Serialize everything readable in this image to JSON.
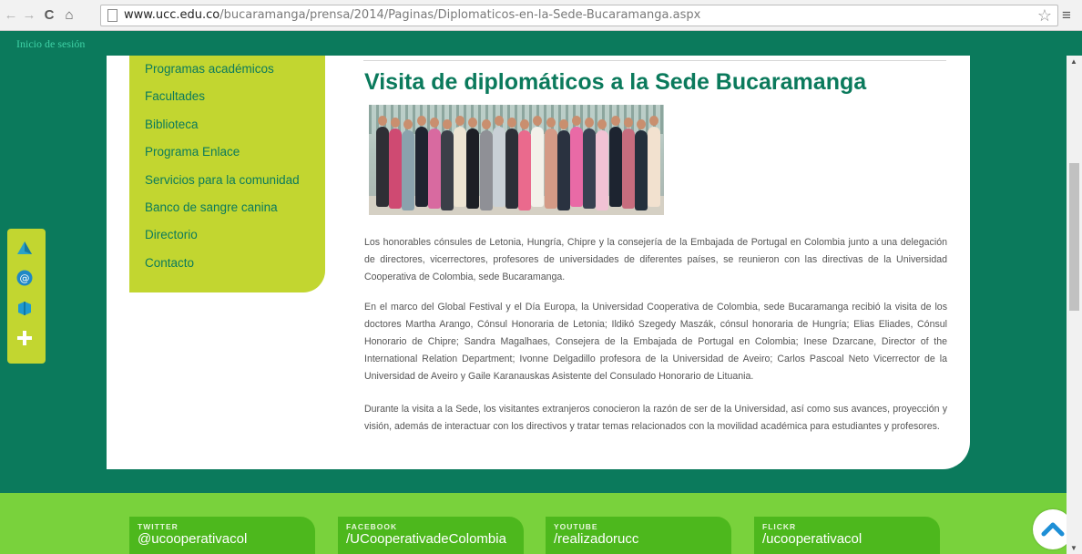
{
  "browser": {
    "url_domain": "www.ucc.edu.co",
    "url_path": "/bucaramanga/prensa/2014/Paginas/Diplomaticos-en-la-Sede-Bucaramanga.aspx",
    "back_icon": "←",
    "forward_icon": "→",
    "reload_icon": "C",
    "home_icon": "⌂",
    "star_icon": "☆",
    "menu_icon": "≡"
  },
  "header": {
    "login": "Inicio de sesión"
  },
  "left_menu": {
    "items": [
      "Programas académicos",
      "Facultades",
      "Biblioteca",
      "Programa Enlace",
      "Servicios para la comunidad",
      "Banco de sangre canina",
      "Directorio",
      "Contacto"
    ]
  },
  "article": {
    "title": "Visita de diplomáticos a la Sede Bucaramanga",
    "paragraphs": [
      "Los honorables cónsules de Letonia, Hungría, Chipre y la consejería de la Embajada de Portugal en Colombia junto a una delegación de directores, vicerrectores, profesores de universidades de diferentes países, se reunieron con las directivas de la Universidad Cooperativa de Colombia, sede Bucaramanga.",
      "En el marco del Global Festival y el Día Europa, la Universidad Cooperativa de Colombia, sede Bucaramanga recibió la visita de los doctores Martha Arango, Cónsul Honoraria de Letonia; Ildikó Szegedy Maszák, cónsul honoraria de Hungría; Elias Eliades, Cónsul Honorario de Chipre; Sandra Magalhaes, Consejera de la Embajada de Portugal en Colombia; Inese Dzarcane, Director of the International Relation Department; Ivonne Delgadillo profesora de la Universidad de Aveiro; Carlos Pascoal Neto Vicerrector de la Universidad de Aveiro y Gaile Karanauskas Asistente del Consulado Honorario de Lituania.",
      "Durante la visita a la Sede, los visitantes extranjeros conocieron la razón de ser de la Universidad, así como sus avances, proyección y visión, además de interactuar con los directivos y tratar temas relacionados con la movilidad académica para estudiantes y profesores."
    ]
  },
  "social": [
    {
      "kicker": "TWITTER",
      "handle": "@ucooperativacol"
    },
    {
      "kicker": "FACEBOOK",
      "handle": "/UCooperativadeColombia"
    },
    {
      "kicker": "YOUTUBE",
      "handle": "/realizadorucc"
    },
    {
      "kicker": "FLICKR",
      "handle": "/ucooperativacol"
    }
  ],
  "colors": {
    "page_bg": "#0b7a5c",
    "menu_bg": "#c2d630",
    "footer_bg": "#79d23c",
    "social_tile": "#4db81d"
  },
  "photo": {
    "person_colors": [
      "#2f2f35",
      "#cf4a72",
      "#8aa2ad",
      "#1f2430",
      "#d86aa0",
      "#3b3f48",
      "#ede4d2",
      "#1d1f25",
      "#8f9096",
      "#c9d0d6",
      "#2c2f37",
      "#ea6a8d",
      "#f3f1ea",
      "#d49a86",
      "#2a3240",
      "#e96aa6",
      "#384051",
      "#f1c2d4",
      "#1d2430",
      "#c76d7e",
      "#24303c",
      "#f2e1cf"
    ]
  }
}
